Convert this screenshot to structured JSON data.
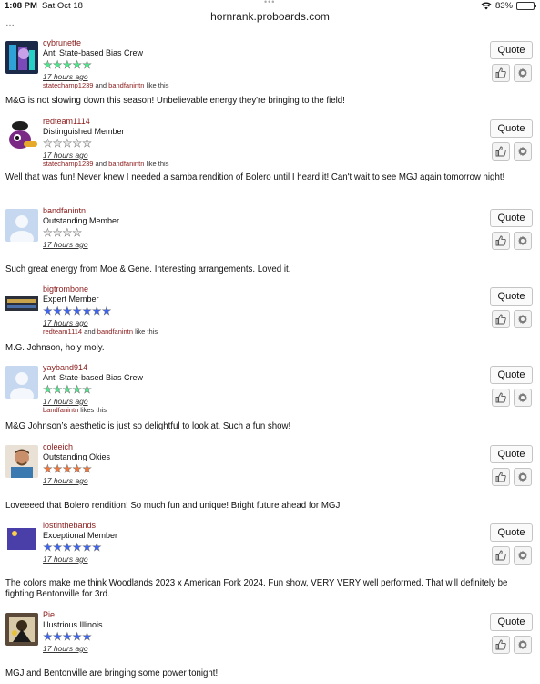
{
  "statusbar": {
    "time": "1:08 PM",
    "date": "Sat Oct 18",
    "battery": "83%",
    "battery_level": 0.83
  },
  "browser": {
    "url": "hornrank.proboards.com",
    "tab_dots": "•••"
  },
  "colors": {
    "username": "#8b1a1a",
    "star_green": "#4ee88c",
    "star_gray": "#e4e4e4",
    "star_blue": "#3c64f0",
    "star_orange": "#f0763c"
  },
  "buttons": {
    "quote": "Quote",
    "like_icon": "thumbs-up-icon",
    "options_icon": "gear-icon"
  },
  "posts": [
    {
      "username": "cybrunette",
      "rank": "Anti State-based Bias Crew",
      "stars": 5,
      "star_color": "#4ee88c",
      "time_ago": "17 hours ago",
      "likes": {
        "users": [
          "statechamp1239",
          "bandfanintn"
        ],
        "suffix": " like this"
      },
      "body": "M&G is not slowing down this season! Unbelievable energy they're bringing to the field!"
    },
    {
      "username": "redteam1114",
      "rank": "Distinguished Member",
      "stars": 5,
      "star_color": "#e4e4e4",
      "time_ago": "17 hours ago",
      "likes": {
        "users": [
          "statechamp1239",
          "bandfanintn"
        ],
        "suffix": " like this"
      },
      "body": "Well that was fun! Never knew I needed a samba rendition of Bolero until I heard it! Can't wait to see MGJ again tomorrow night!"
    },
    {
      "username": "bandfanintn",
      "rank": "Outstanding Member",
      "stars": 4,
      "star_color": "#e4e4e4",
      "time_ago": "17 hours ago",
      "likes": null,
      "body": "Such great energy from Moe & Gene. Interesting arrangements. Loved it."
    },
    {
      "username": "bigtrombone",
      "rank": "Expert Member",
      "stars": 7,
      "star_color": "#3c64f0",
      "time_ago": "17 hours ago",
      "likes": {
        "users": [
          "redteam1114",
          "bandfanintn"
        ],
        "suffix": " like this"
      },
      "body": "M.G. Johnson, holy moly."
    },
    {
      "username": "yayband914",
      "rank": "Anti State-based Bias Crew",
      "stars": 5,
      "star_color": "#4ee88c",
      "time_ago": "17 hours ago",
      "likes": {
        "users": [
          "bandfanintn"
        ],
        "suffix": " likes this"
      },
      "body": "M&G Johnson’s aesthetic is just so delightful to look at. Such a fun show!"
    },
    {
      "username": "coleeich",
      "rank": "Outstanding Okies",
      "stars": 5,
      "star_color": "#f0763c",
      "time_ago": "17 hours ago",
      "likes": null,
      "body": "Loveeeed that Bolero rendition! So much fun and unique! Bright future ahead for MGJ"
    },
    {
      "username": "lostinthebands",
      "rank": "Exceptional Member",
      "stars": 6,
      "star_color": "#3c64f0",
      "time_ago": "17 hours ago",
      "likes": null,
      "body": "The colors make me think Woodlands 2023 x American Fork 2024. Fun show, VERY VERY well performed. That will definitely be fighting Bentonville for 3rd."
    },
    {
      "username": "Pie",
      "rank": "Illustrious Illinois",
      "stars": 5,
      "star_color": "#3c64f0",
      "time_ago": "17 hours ago",
      "likes": null,
      "body": "MGJ and Bentonville are bringing some power tonight!"
    }
  ]
}
